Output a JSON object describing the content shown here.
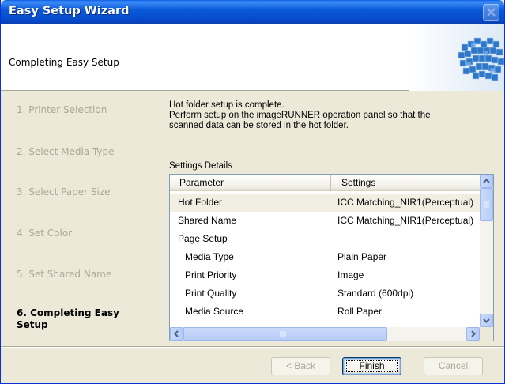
{
  "window": {
    "title": "Easy Setup Wizard"
  },
  "header": {
    "title": "Completing Easy Setup"
  },
  "steps": [
    {
      "label": "1.  Printer Selection",
      "active": false
    },
    {
      "label": "2.  Select Media Type",
      "active": false
    },
    {
      "label": "3.  Select Paper Size",
      "active": false
    },
    {
      "label": "4.  Set Color",
      "active": false
    },
    {
      "label": "5.  Set Shared Name",
      "active": false
    },
    {
      "label": "6.  Completing Easy Setup",
      "active": true
    }
  ],
  "message": {
    "line1": "Hot folder setup is complete.",
    "line2": "Perform setup on the imageRUNNER operation panel so that the",
    "line3": "scanned data can be stored in the hot folder."
  },
  "details": {
    "label": "Settings Details",
    "columns": {
      "parameter": "Parameter",
      "settings": "Settings"
    },
    "rows": [
      {
        "param": "Hot Folder",
        "value": "ICC Matching_NIR1(Perceptual)"
      },
      {
        "param": "Shared Name",
        "value": "ICC Matching_NIR1(Perceptual)"
      },
      {
        "param": "Page Setup",
        "value": ""
      },
      {
        "param": "Media Type",
        "value": "Plain Paper"
      },
      {
        "param": "Print Priority",
        "value": "Image"
      },
      {
        "param": "Print Quality",
        "value": "Standard (600dpi)"
      },
      {
        "param": "Media Source",
        "value": "Roll Paper"
      }
    ]
  },
  "buttons": {
    "back": "< Back",
    "finish": "Finish",
    "cancel": "Cancel"
  },
  "colors": {
    "titlebar": "#0A5FE6",
    "face": "#ECE9D8",
    "selected_row": "#F1EFE2"
  }
}
